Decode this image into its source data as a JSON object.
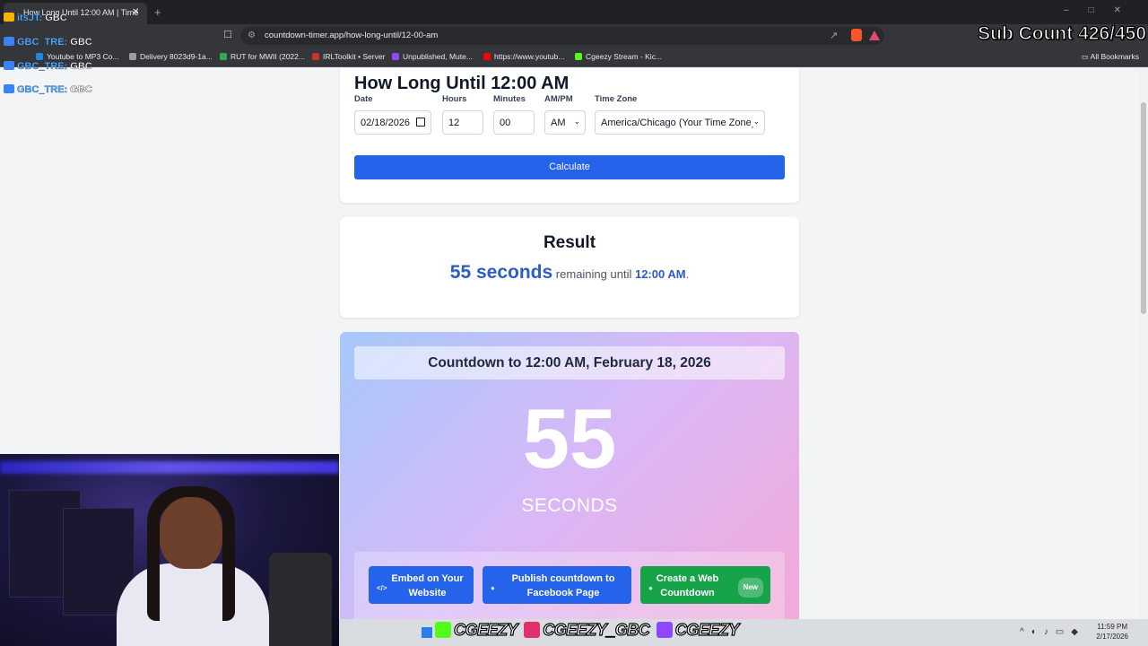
{
  "browser": {
    "tab_title": "How Long Until 12:00 AM | Time",
    "tab_close": "✕",
    "new_tab": "+",
    "url": "countdown-timer.app/how-long-until/12-00-am",
    "bookmarks": [
      {
        "label": "Youtube to MP3 Co...",
        "color": "#1e88e5"
      },
      {
        "label": "Delivery 8023d9-1a...",
        "color": "#9e9e9e"
      },
      {
        "label": "RUT for MWII (2022...",
        "color": "#34a853"
      },
      {
        "label": "IRLToolkit • Server",
        "color": "#d32f2f"
      },
      {
        "label": "Unpublished, Mute...",
        "color": "#9146ff"
      },
      {
        "label": "https://www.youtub...",
        "color": "#ff0000"
      },
      {
        "label": "Cgeezy Stream - Kic...",
        "color": "#53fc18"
      }
    ],
    "all_bookmarks": "All Bookmarks"
  },
  "form": {
    "title": "How Long Until 12:00 AM",
    "date_label": "Date",
    "date_value": "02/18/2026",
    "hours_label": "Hours",
    "hours_value": "12",
    "minutes_label": "Minutes",
    "minutes_value": "00",
    "ampm_label": "AM/PM",
    "ampm_value": "AM",
    "timezone_label": "Time Zone",
    "timezone_value": "America/Chicago (Your Time Zone)",
    "calculate_label": "Calculate"
  },
  "result": {
    "title": "Result",
    "amount": "55 seconds",
    "middle": " remaining until ",
    "time": "12:00 AM",
    "end": "."
  },
  "countdown": {
    "header": "Countdown to 12:00 AM, February 18, 2026",
    "number": "55",
    "unit": "SECONDS",
    "embed_label": "Embed on Your Website",
    "facebook_label": "Publish countdown to Facebook Page",
    "create_label": "Create a Web Countdown",
    "new_badge": "New"
  },
  "overlay": {
    "chat": [
      {
        "user": "itsJT:",
        "msg": "GBC"
      },
      {
        "user": "GBC_TRE:",
        "msg": "GBC"
      },
      {
        "user": "GBC_TRE:",
        "msg": "GBC"
      },
      {
        "user": "GBC_TRE:",
        "msg": "GBC"
      }
    ],
    "sub_count": "Sub Count 426/450",
    "socials": [
      "CGEEZY",
      "CGEEZY_GBC",
      "CGEEZY"
    ]
  },
  "taskbar": {
    "time": "11:59 PM",
    "date": "2/17/2026"
  }
}
